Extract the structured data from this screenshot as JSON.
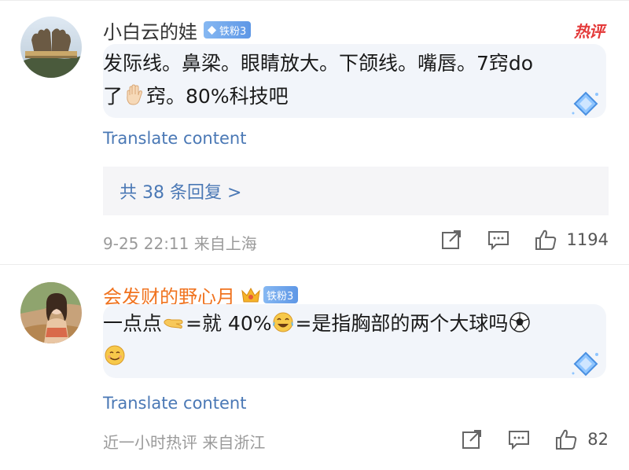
{
  "comments": [
    {
      "username": "小白云的娃",
      "fan_badge": "铁粉3",
      "hot_tag": "热评",
      "text_line1": "发际线。鼻梁。眼睛放大。下颌线。嘴唇。7窍do",
      "text_line2_a": "了",
      "text_line2_b": "窍。80%科技吧",
      "translate": "Translate content",
      "replies": "共 38 条回复 >",
      "meta": "9-25 22:11 来自上海",
      "likes": "1194"
    },
    {
      "username": "会发财的野心月",
      "fan_badge": "铁粉3",
      "text_a": "一点点",
      "text_b": "=就 40%",
      "text_c": "=是指胸部的两个大球吗",
      "translate": "Translate content",
      "meta": "近一小时热评  来自浙江",
      "likes": "82"
    }
  ],
  "colors": {
    "link": "#4a78b5",
    "username_vip": "#f0731f",
    "hot": "#e43a3a",
    "bubble": "#f2f5fa"
  }
}
